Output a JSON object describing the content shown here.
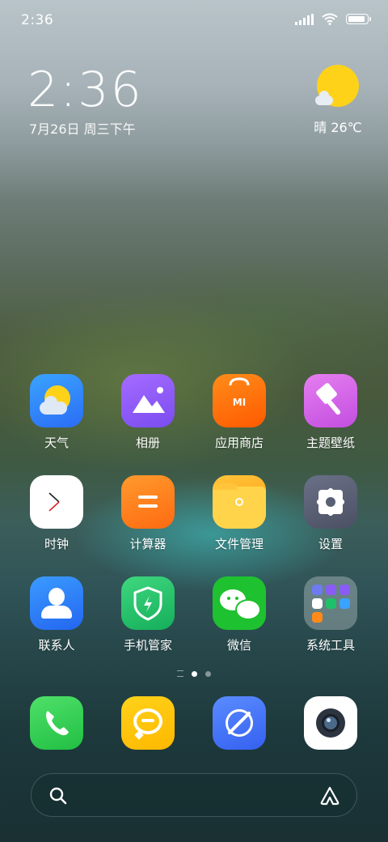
{
  "status_bar": {
    "time": "2:36",
    "signal_icon": "signal-icon",
    "wifi_icon": "wifi-icon",
    "battery_icon": "battery-icon"
  },
  "clock_widget": {
    "time": "2:36",
    "date": "7月26日 周三下午"
  },
  "weather_widget": {
    "condition_icon": "sun-cloud-icon",
    "text": "晴 26℃"
  },
  "apps": [
    {
      "label": "天气",
      "icon": "weather-icon"
    },
    {
      "label": "相册",
      "icon": "gallery-icon"
    },
    {
      "label": "应用商店",
      "icon": "app-store-icon"
    },
    {
      "label": "主题壁纸",
      "icon": "theme-brush-icon"
    },
    {
      "label": "时钟",
      "icon": "clock-icon"
    },
    {
      "label": "计算器",
      "icon": "calculator-icon"
    },
    {
      "label": "文件管理",
      "icon": "folder-icon"
    },
    {
      "label": "设置",
      "icon": "settings-gear-icon"
    },
    {
      "label": "联系人",
      "icon": "contacts-icon"
    },
    {
      "label": "手机管家",
      "icon": "security-shield-icon"
    },
    {
      "label": "微信",
      "icon": "wechat-icon"
    },
    {
      "label": "系统工具",
      "icon": "folder-system-tools-icon"
    }
  ],
  "app_store_logo_text": "MI",
  "page_indicator": {
    "pages": 2,
    "current": 1
  },
  "dock": [
    {
      "icon": "phone-icon"
    },
    {
      "icon": "messages-icon"
    },
    {
      "icon": "browser-icon"
    },
    {
      "icon": "camera-icon"
    }
  ],
  "search_bar": {
    "search_icon": "search-icon",
    "assistant_icon": "assistant-icon"
  },
  "colors": {
    "weather": "#2f8cff",
    "gallery": "#8a5cf6",
    "store": "#ff6a00",
    "theme": "#d85be8",
    "calculator": "#ff7a1a",
    "files": "#ffb422",
    "settings": "#5c6275",
    "contacts": "#2a7dff",
    "security": "#22c26b",
    "wechat": "#1bbd2f",
    "phone": "#2ecf4e",
    "messages": "#ffc400",
    "browser": "#3f72ff"
  }
}
